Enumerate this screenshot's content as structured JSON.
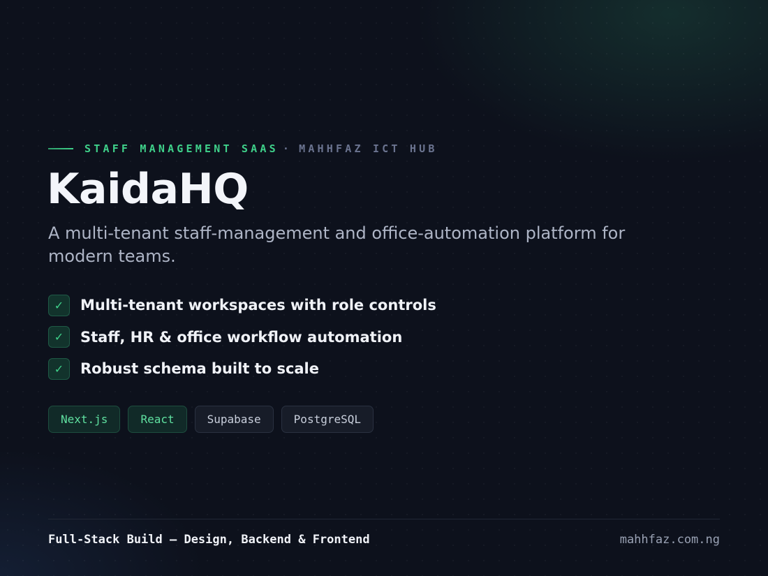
{
  "eyebrow": {
    "primary": "STAFF MANAGEMENT SAAS",
    "separator": "·",
    "secondary": "MAHHFAZ ICT HUB"
  },
  "title": "KaidaHQ",
  "subtitle": "A multi-tenant staff-management and office-automation platform for modern teams.",
  "features": [
    {
      "icon": "check-icon",
      "label": "Multi-tenant workspaces with role controls"
    },
    {
      "icon": "check-icon",
      "label": "Staff, HR & office workflow automation"
    },
    {
      "icon": "check-icon",
      "label": "Robust schema built to scale"
    }
  ],
  "check_glyph": "✓",
  "tags": [
    {
      "label": "Next.js",
      "style": "accent"
    },
    {
      "label": "React",
      "style": "accent"
    },
    {
      "label": "Supabase",
      "style": "neutral"
    },
    {
      "label": "PostgreSQL",
      "style": "neutral"
    }
  ],
  "footer": {
    "left": "Full-Stack Build — Design, Backend & Frontend",
    "right": "mahhfaz.com.ng"
  },
  "colors": {
    "background": "#0d111c",
    "accent": "#3fd18a",
    "muted": "#6b7490",
    "text": "#f0f2f7"
  }
}
